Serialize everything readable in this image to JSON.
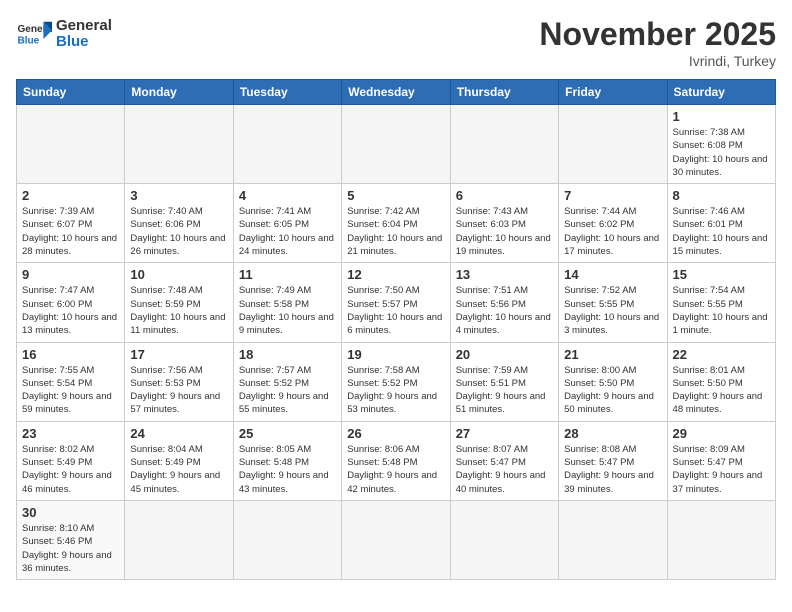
{
  "header": {
    "title": "November 2025",
    "location": "Ivrindi, Turkey",
    "logo_general": "General",
    "logo_blue": "Blue"
  },
  "weekdays": [
    "Sunday",
    "Monday",
    "Tuesday",
    "Wednesday",
    "Thursday",
    "Friday",
    "Saturday"
  ],
  "days": [
    {
      "date": "",
      "info": ""
    },
    {
      "date": "",
      "info": ""
    },
    {
      "date": "",
      "info": ""
    },
    {
      "date": "",
      "info": ""
    },
    {
      "date": "",
      "info": ""
    },
    {
      "date": "",
      "info": ""
    },
    {
      "date": "1",
      "info": "Sunrise: 7:38 AM\nSunset: 6:08 PM\nDaylight: 10 hours\nand 30 minutes."
    },
    {
      "date": "2",
      "info": "Sunrise: 7:39 AM\nSunset: 6:07 PM\nDaylight: 10 hours\nand 28 minutes."
    },
    {
      "date": "3",
      "info": "Sunrise: 7:40 AM\nSunset: 6:06 PM\nDaylight: 10 hours\nand 26 minutes."
    },
    {
      "date": "4",
      "info": "Sunrise: 7:41 AM\nSunset: 6:05 PM\nDaylight: 10 hours\nand 24 minutes."
    },
    {
      "date": "5",
      "info": "Sunrise: 7:42 AM\nSunset: 6:04 PM\nDaylight: 10 hours\nand 21 minutes."
    },
    {
      "date": "6",
      "info": "Sunrise: 7:43 AM\nSunset: 6:03 PM\nDaylight: 10 hours\nand 19 minutes."
    },
    {
      "date": "7",
      "info": "Sunrise: 7:44 AM\nSunset: 6:02 PM\nDaylight: 10 hours\nand 17 minutes."
    },
    {
      "date": "8",
      "info": "Sunrise: 7:46 AM\nSunset: 6:01 PM\nDaylight: 10 hours\nand 15 minutes."
    },
    {
      "date": "9",
      "info": "Sunrise: 7:47 AM\nSunset: 6:00 PM\nDaylight: 10 hours\nand 13 minutes."
    },
    {
      "date": "10",
      "info": "Sunrise: 7:48 AM\nSunset: 5:59 PM\nDaylight: 10 hours\nand 11 minutes."
    },
    {
      "date": "11",
      "info": "Sunrise: 7:49 AM\nSunset: 5:58 PM\nDaylight: 10 hours\nand 9 minutes."
    },
    {
      "date": "12",
      "info": "Sunrise: 7:50 AM\nSunset: 5:57 PM\nDaylight: 10 hours\nand 6 minutes."
    },
    {
      "date": "13",
      "info": "Sunrise: 7:51 AM\nSunset: 5:56 PM\nDaylight: 10 hours\nand 4 minutes."
    },
    {
      "date": "14",
      "info": "Sunrise: 7:52 AM\nSunset: 5:55 PM\nDaylight: 10 hours\nand 3 minutes."
    },
    {
      "date": "15",
      "info": "Sunrise: 7:54 AM\nSunset: 5:55 PM\nDaylight: 10 hours\nand 1 minute."
    },
    {
      "date": "16",
      "info": "Sunrise: 7:55 AM\nSunset: 5:54 PM\nDaylight: 9 hours\nand 59 minutes."
    },
    {
      "date": "17",
      "info": "Sunrise: 7:56 AM\nSunset: 5:53 PM\nDaylight: 9 hours\nand 57 minutes."
    },
    {
      "date": "18",
      "info": "Sunrise: 7:57 AM\nSunset: 5:52 PM\nDaylight: 9 hours\nand 55 minutes."
    },
    {
      "date": "19",
      "info": "Sunrise: 7:58 AM\nSunset: 5:52 PM\nDaylight: 9 hours\nand 53 minutes."
    },
    {
      "date": "20",
      "info": "Sunrise: 7:59 AM\nSunset: 5:51 PM\nDaylight: 9 hours\nand 51 minutes."
    },
    {
      "date": "21",
      "info": "Sunrise: 8:00 AM\nSunset: 5:50 PM\nDaylight: 9 hours\nand 50 minutes."
    },
    {
      "date": "22",
      "info": "Sunrise: 8:01 AM\nSunset: 5:50 PM\nDaylight: 9 hours\nand 48 minutes."
    },
    {
      "date": "23",
      "info": "Sunrise: 8:02 AM\nSunset: 5:49 PM\nDaylight: 9 hours\nand 46 minutes."
    },
    {
      "date": "24",
      "info": "Sunrise: 8:04 AM\nSunset: 5:49 PM\nDaylight: 9 hours\nand 45 minutes."
    },
    {
      "date": "25",
      "info": "Sunrise: 8:05 AM\nSunset: 5:48 PM\nDaylight: 9 hours\nand 43 minutes."
    },
    {
      "date": "26",
      "info": "Sunrise: 8:06 AM\nSunset: 5:48 PM\nDaylight: 9 hours\nand 42 minutes."
    },
    {
      "date": "27",
      "info": "Sunrise: 8:07 AM\nSunset: 5:47 PM\nDaylight: 9 hours\nand 40 minutes."
    },
    {
      "date": "28",
      "info": "Sunrise: 8:08 AM\nSunset: 5:47 PM\nDaylight: 9 hours\nand 39 minutes."
    },
    {
      "date": "29",
      "info": "Sunrise: 8:09 AM\nSunset: 5:47 PM\nDaylight: 9 hours\nand 37 minutes."
    },
    {
      "date": "30",
      "info": "Sunrise: 8:10 AM\nSunset: 5:46 PM\nDaylight: 9 hours\nand 36 minutes."
    },
    {
      "date": "",
      "info": ""
    },
    {
      "date": "",
      "info": ""
    },
    {
      "date": "",
      "info": ""
    },
    {
      "date": "",
      "info": ""
    },
    {
      "date": "",
      "info": ""
    },
    {
      "date": "",
      "info": ""
    }
  ]
}
